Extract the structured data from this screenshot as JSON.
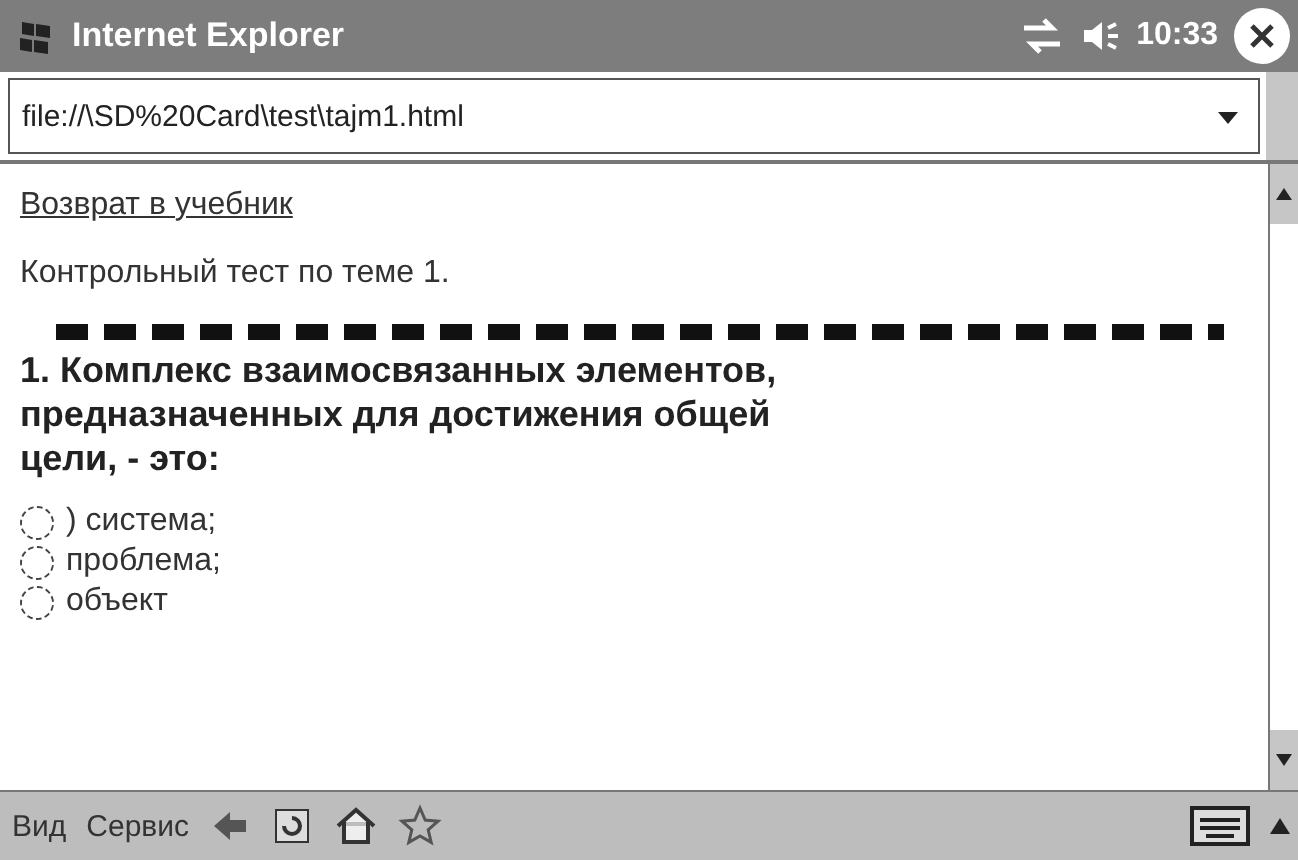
{
  "window": {
    "title": "Internet Explorer",
    "clock": "10:33"
  },
  "address_bar": {
    "value": "file://\\SD%20Card\\test\\tajm1.html"
  },
  "content": {
    "link": "Возврат в учебник",
    "subtitle": "Контрольный тест по теме 1.",
    "question": "1. Комплекс взаимосвязанных элементов, предназначенных для достижения общей цели, - это:",
    "options": [
      {
        "label": ") система;",
        "selected": false
      },
      {
        "label": "проблема;",
        "selected": false
      },
      {
        "label": "объект",
        "selected": false
      }
    ]
  },
  "toolbar": {
    "menus": [
      "Вид",
      "Сервис"
    ]
  }
}
